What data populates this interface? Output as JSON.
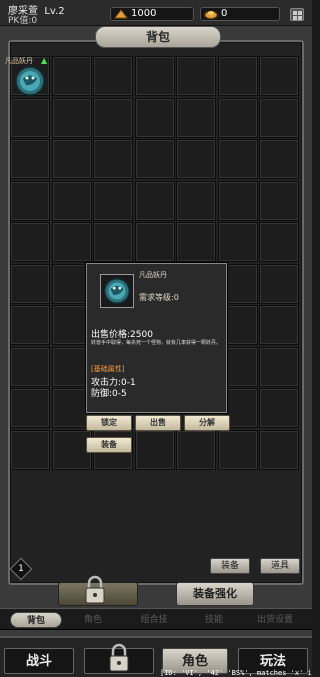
{
  "player": {
    "name": "廖采萱",
    "level": "Lv.2",
    "pk": "PK值:0"
  },
  "resources": {
    "gold": "1000",
    "ingot": "0"
  },
  "panel": {
    "title": "背包"
  },
  "slot": {
    "label": "凡品妖丹"
  },
  "tooltip": {
    "name": "凡品妖丹",
    "requirement": "需求等级:0",
    "price": "出售价格:2500",
    "description": "妖兽手中取得，每杀死一个怪物，就有几率获得一颗妖丹。",
    "basic_attr_title": "[基础属性]",
    "attack": "攻击力:0-1",
    "defense": "防御:0-5",
    "buttons": {
      "lock": "锁定",
      "sell": "出售",
      "decompose": "分解",
      "equip": "装备"
    }
  },
  "bag_tabs": {
    "equipment": "装备",
    "props": "道具"
  },
  "page_badge": "1",
  "enhance_label": "装备强化",
  "sub_nav": [
    "背包",
    "角色",
    "组合技",
    "技能",
    "出货设置"
  ],
  "bottom_nav": {
    "battle": "战斗",
    "role": "角色",
    "play": "玩法"
  },
  "footer_text": "[ID: 'VI', '42' 'BS%', matches 'x' in"
}
